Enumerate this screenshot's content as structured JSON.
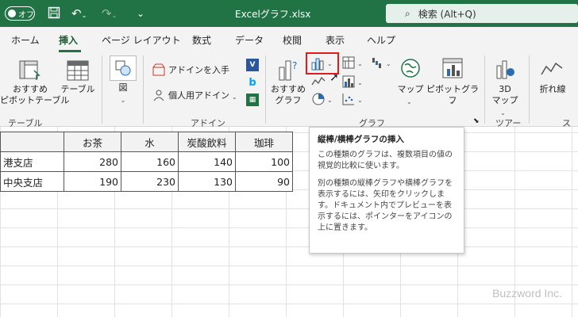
{
  "titlebar": {
    "autosave_label": "オフ",
    "doc_title": "Excelグラフ.xlsx",
    "search_placeholder": "検索 (Alt+Q)"
  },
  "tabs": [
    "ホーム",
    "挿入",
    "ページ レイアウト",
    "数式",
    "データ",
    "校閲",
    "表示",
    "ヘルプ"
  ],
  "active_tab": "挿入",
  "ribbon": {
    "recommended_pivot": "おすすめ\nピボットテーブル",
    "table": "テーブル",
    "figure": "図",
    "get_addins": "アドインを入手",
    "my_addins": "個人用アドイン",
    "recommended_charts": "おすすめ\nグラフ",
    "map": "マップ",
    "pivot_chart": "ピボットグラフ",
    "map3d": "3D\nマップ",
    "line": "折れ線",
    "spark_partial": "スパ",
    "groups": {
      "table": "テーブル",
      "addin": "アドイン",
      "chart": "グラフ",
      "tour": "ツアー"
    }
  },
  "table": {
    "headers": [
      "",
      "お茶",
      "水",
      "炭酸飲料",
      "珈琲"
    ],
    "rows": [
      [
        "港支店",
        "280",
        "160",
        "140",
        "100"
      ],
      [
        "中央支店",
        "190",
        "230",
        "130",
        "90"
      ]
    ]
  },
  "tooltip": {
    "title": "縦棒/横棒グラフの挿入",
    "p1": "この種類のグラフは、複数項目の値の視覚的比較に使います。",
    "p2": "別の種類の縦棒グラフや横棒グラフを表示するには、矢印をクリックします。ドキュメント内でプレビューを表示するには、ポインターをアイコンの上に置きます。"
  },
  "watermark": "Buzzword Inc.",
  "colors": {
    "accent": "#217346",
    "highlight": "#e01b1b"
  }
}
